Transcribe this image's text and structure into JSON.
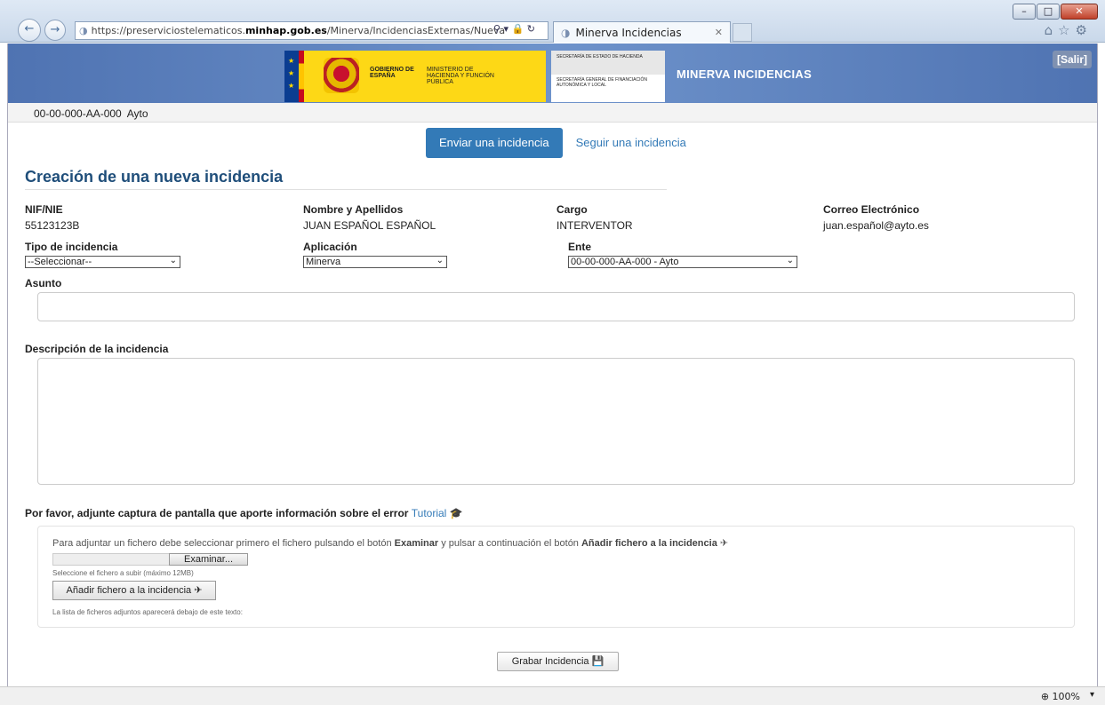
{
  "browser": {
    "url_prefix": "https://preserviciostelematicos.",
    "url_domain": "minhap.gob.es",
    "url_path": "/Minerva/IncidenciasExternas/Nueva",
    "tab_title": "Minerva Incidencias",
    "zoom": "100%"
  },
  "header": {
    "gobierno": "GOBIERNO DE ESPAÑA",
    "ministerio": "MINISTERIO DE HACIENDA Y FUNCIÓN PÚBLICA",
    "secretaria_estado": "SECRETARÍA DE ESTADO DE HACIENDA",
    "secretaria_general": "SECRETARÍA GENERAL DE FINANCIACIÓN AUTONÓMICA Y LOCAL",
    "app_title": "MINERVA INCIDENCIAS",
    "logout_label": "[Salir]"
  },
  "user_bar": {
    "entity": "00-00-000-AA-000  Ayto"
  },
  "nav": {
    "send_label": "Enviar una incidencia",
    "follow_label": "Seguir una incidencia"
  },
  "form": {
    "title": "Creación de una nueva incidencia",
    "nif_label": "NIF/NIE",
    "nif_value": "55123123B",
    "name_label": "Nombre y Apellidos",
    "name_value": "JUAN ESPAÑOL ESPAÑOL",
    "cargo_label": "Cargo",
    "cargo_value": "INTERVENTOR",
    "email_label": "Correo Electrónico",
    "email_value": "juan.español@ayto.es",
    "tipo_label": "Tipo de incidencia",
    "tipo_value": "--Seleccionar--",
    "app_label": "Aplicación",
    "app_value": "Minerva",
    "ente_label": "Ente",
    "ente_value": "00-00-000-AA-000 - Ayto",
    "asunto_label": "Asunto",
    "asunto_value": "",
    "desc_label": "Descripción de la incidencia",
    "desc_value": ""
  },
  "attach": {
    "prompt": "Por favor, adjunte captura de pantalla que aporte información sobre el error",
    "tutorial_label": "Tutorial",
    "help_1": "Para adjuntar un fichero debe seleccionar primero el fichero pulsando el botón ",
    "help_examinar": "Examinar",
    "help_2": " y pulsar a continuación el botón ",
    "help_add": "Añadir fichero a la incidencia",
    "browse_label": "Examinar...",
    "size_note": "Seleccione el fichero a subir (máximo 12MB)",
    "add_label": "Añadir fichero a la incidencia",
    "list_note": "La lista de ficheros adjuntos aparecerá debajo de este texto:"
  },
  "save_label": "Grabar Incidencia",
  "colors": {
    "banner": "#5a7fbe",
    "primary": "#337ab7",
    "heading": "#1f4e7a",
    "gov_yellow": "#fdd816"
  }
}
